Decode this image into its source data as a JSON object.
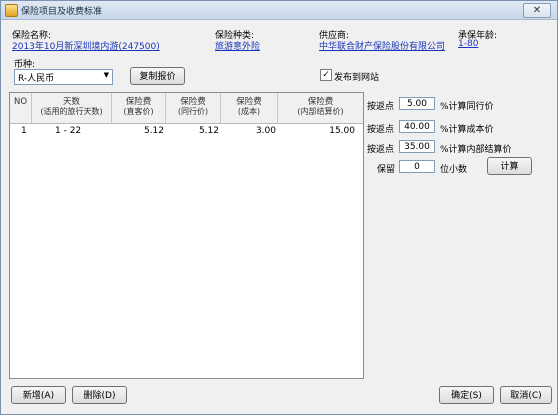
{
  "window": {
    "title": "保险项目及收费标准",
    "close_glyph": "✕"
  },
  "info": {
    "name_label": "保险名称:",
    "name_value": "2013年10月新深圳境内游(247500)",
    "type_label": "保险种类:",
    "type_value": "旅游意外险",
    "supplier_label": "供应商:",
    "supplier_value": "中华联合财产保险股份有限公司",
    "age_label": "承保年龄:",
    "age_value": "1-80"
  },
  "currency": {
    "label": "币种:",
    "selected": "R-人民币"
  },
  "buttons": {
    "copy_price": "复制报价",
    "calculate": "计算",
    "add": "新增(A)",
    "delete": "删除(D)",
    "ok": "确定(S)",
    "cancel": "取消(C)"
  },
  "publish": {
    "checked": true,
    "label": "发布到网站"
  },
  "table": {
    "headers": [
      {
        "line1": "NO",
        "line2": ""
      },
      {
        "line1": "天数",
        "line2": "(适用的旅行天数)"
      },
      {
        "line1": "保险费",
        "line2": "(直客价)"
      },
      {
        "line1": "保险费",
        "line2": "(同行价)"
      },
      {
        "line1": "保险费",
        "line2": "(成本)"
      },
      {
        "line1": "保险费",
        "line2": "(内部结算价)"
      }
    ],
    "rows": [
      {
        "no": "1",
        "days": "1  -  22",
        "direct": "5.12",
        "peer": "5.12",
        "cost": "3.00",
        "internal": "15.00"
      }
    ]
  },
  "pricing": [
    {
      "label": "按返点",
      "value": "5.00",
      "suffix": "%计算同行价"
    },
    {
      "label": "按返点",
      "value": "40.00",
      "suffix": "%计算成本价"
    },
    {
      "label": "按返点",
      "value": "35.00",
      "suffix": "%计算内部结算价"
    }
  ],
  "decimals": {
    "label": "保留",
    "value": "0",
    "suffix": "位小数"
  }
}
